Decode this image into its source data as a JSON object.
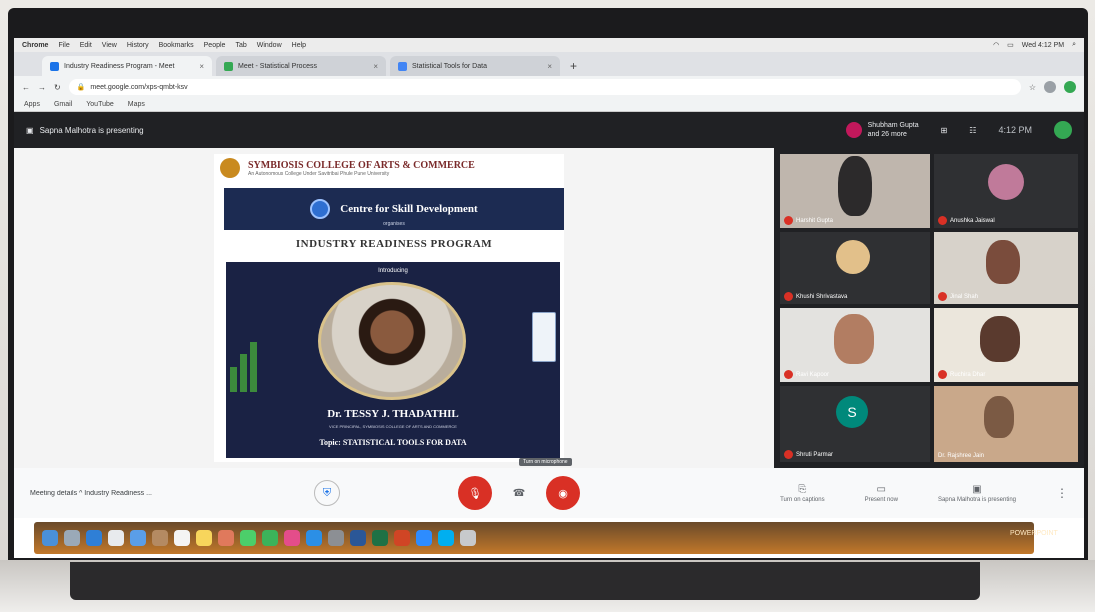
{
  "menubar": {
    "items": [
      "Chrome",
      "File",
      "Edit",
      "View",
      "History",
      "Bookmarks",
      "People",
      "Tab",
      "Window",
      "Help"
    ],
    "clock": "Wed 4:12 PM"
  },
  "browser": {
    "tabs": [
      {
        "label": "Industry Readiness Program - Meet"
      },
      {
        "label": "Meet - Statistical Process"
      },
      {
        "label": "Statistical Tools for Data"
      }
    ],
    "url": "meet.google.com/xps-qmbt-ksv",
    "bookmarks": [
      "Apps",
      "Gmail",
      "YouTube",
      "Maps"
    ]
  },
  "meet_bar": {
    "presenting_text": "Sapna Malhotra is presenting",
    "joined_line1": "Shubham Gupta",
    "joined_line2": "and 26 more",
    "time": "4:12 PM"
  },
  "slide": {
    "college_name": "SYMBIOSIS COLLEGE OF ARTS & COMMERCE",
    "college_sub": "An Autonomous College Under Savitribai Phule Pune University",
    "centre": "Centre for Skill Development",
    "organises": "organises",
    "program": "INDUSTRY READINESS PROGRAM",
    "introducing": "Introducing",
    "speaker": "Dr. TESSY J. THADATHIL",
    "role": "VICE PRINCIPAL, SYMBIOSIS COLLEGE OF ARTS AND COMMERCE",
    "topic": "Topic: STATISTICAL TOOLS FOR DATA"
  },
  "participants": [
    {
      "name": "Harshit Gupta",
      "mic_off": true
    },
    {
      "name": "Anushka Jaiswal",
      "mic_off": true
    },
    {
      "name": "Khushi Shrivastava",
      "mic_off": true
    },
    {
      "name": "Jinal Shah",
      "mic_off": true
    },
    {
      "name": "Ravi Kapoor",
      "mic_off": true
    },
    {
      "name": "Ruchira Dhar",
      "mic_off": true
    },
    {
      "name": "Shruti Parmar",
      "mic_off": true,
      "initial": "S"
    },
    {
      "name": "Dr. Rajshree Jain",
      "mic_off": false
    }
  ],
  "controls": {
    "meeting_name": "Meeting details ^  Industry Readiness ...",
    "tooltip": "Turn on microphone",
    "turn_on_captions": "Turn on captions",
    "present_now": "Present now",
    "stop_presenting": "Sapna Malhotra is presenting"
  },
  "dock": {
    "status": "POWERPOINT"
  },
  "colors": {
    "meet_dark": "#202124",
    "leave_red": "#d93025",
    "slide_navy": "#1c2b52",
    "dock_orange": "#c2782a"
  }
}
